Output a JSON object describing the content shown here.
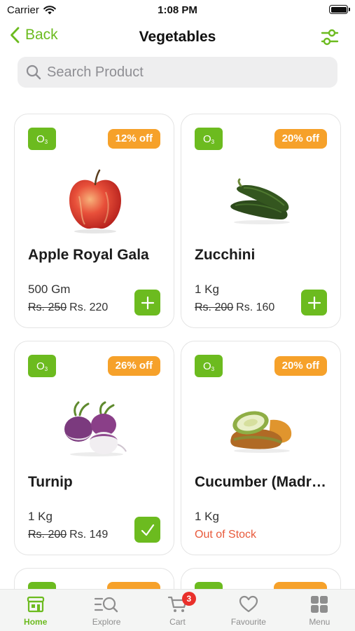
{
  "status_bar": {
    "carrier": "Carrier",
    "time": "1:08 PM"
  },
  "nav": {
    "back_label": "Back",
    "title": "Vegetables"
  },
  "search": {
    "placeholder": "Search Product",
    "value": ""
  },
  "products": [
    {
      "badge": "O",
      "badge_sub": "3",
      "discount": "12% off",
      "name": "Apple Royal Gala",
      "quantity": "500 Gm",
      "old_price": "Rs. 250",
      "new_price": "Rs. 220",
      "in_cart": false,
      "icon": "apple-image"
    },
    {
      "badge": "O",
      "badge_sub": "3",
      "discount": "20% off",
      "name": "Zucchini",
      "quantity": "1 Kg",
      "old_price": "Rs. 200",
      "new_price": "Rs. 160",
      "in_cart": false,
      "icon": "zucchini-image"
    },
    {
      "badge": "O",
      "badge_sub": "3",
      "discount": "26% off",
      "name": "Turnip",
      "quantity": "1 Kg",
      "old_price": "Rs. 200",
      "new_price": "Rs. 149",
      "in_cart": true,
      "icon": "turnip-image"
    },
    {
      "badge": "O",
      "badge_sub": "3",
      "discount": "20% off",
      "name": "Cucumber (Madras)",
      "quantity": "1 Kg",
      "stock_status": "Out of Stock",
      "icon": "cucumber-image"
    }
  ],
  "tabs": [
    {
      "label": "Home",
      "icon": "home-icon",
      "active": true
    },
    {
      "label": "Explore",
      "icon": "explore-icon",
      "active": false
    },
    {
      "label": "Cart",
      "icon": "cart-icon",
      "active": false,
      "badge": "3"
    },
    {
      "label": "Favourite",
      "icon": "heart-icon",
      "active": false
    },
    {
      "label": "Menu",
      "icon": "menu-grid-icon",
      "active": false
    }
  ],
  "colors": {
    "accent": "#6cbb1f",
    "discount": "#f6a12a",
    "out_of_stock": "#e8593a",
    "cart_badge": "#e9302b"
  }
}
